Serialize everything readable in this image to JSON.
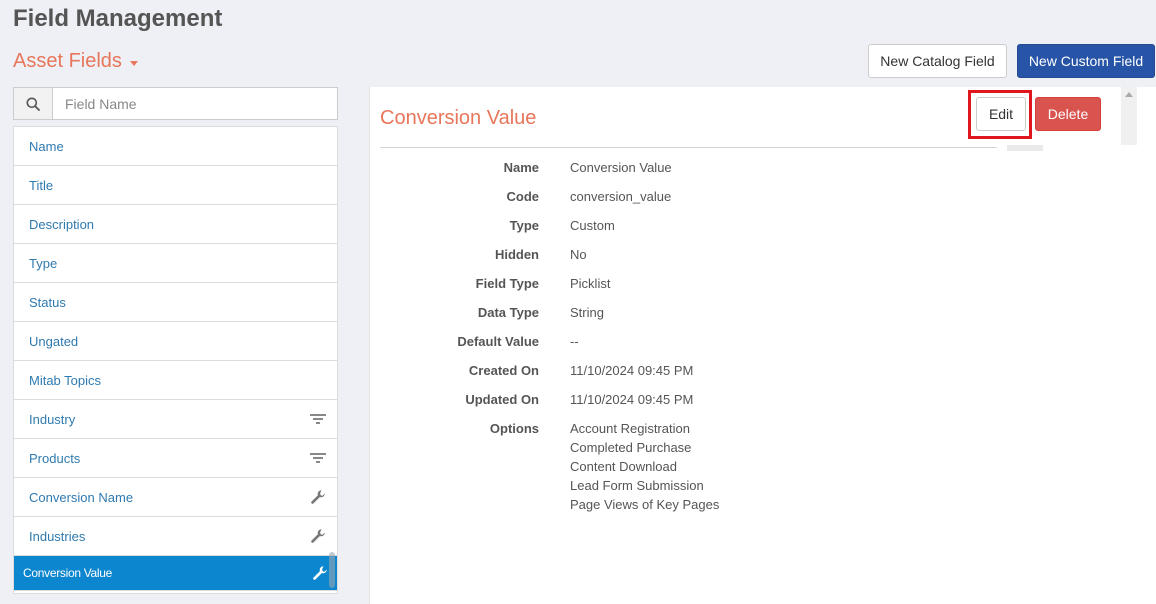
{
  "page": {
    "title": "Field Management"
  },
  "section": {
    "title": "Asset Fields"
  },
  "toolbar": {
    "new_catalog_label": "New Catalog Field",
    "new_custom_label": "New Custom Field"
  },
  "search": {
    "placeholder": "Field Name",
    "value": ""
  },
  "fields": [
    {
      "label": "Name",
      "icon": ""
    },
    {
      "label": "Title",
      "icon": ""
    },
    {
      "label": "Description",
      "icon": ""
    },
    {
      "label": "Type",
      "icon": ""
    },
    {
      "label": "Status",
      "icon": ""
    },
    {
      "label": "Ungated",
      "icon": ""
    },
    {
      "label": "Mitab Topics",
      "icon": ""
    },
    {
      "label": "Industry",
      "icon": "filter-icon"
    },
    {
      "label": "Products",
      "icon": "filter-icon"
    },
    {
      "label": "Conversion Name",
      "icon": "wrench-icon"
    },
    {
      "label": "Industries",
      "icon": "wrench-icon"
    },
    {
      "label": "Conversion Value",
      "icon": "wrench-icon",
      "selected": true
    }
  ],
  "detail": {
    "title": "Conversion Value",
    "edit_label": "Edit",
    "delete_label": "Delete",
    "properties": [
      {
        "label": "Name",
        "value": "Conversion Value"
      },
      {
        "label": "Code",
        "value": "conversion_value"
      },
      {
        "label": "Type",
        "value": "Custom"
      },
      {
        "label": "Hidden",
        "value": "No"
      },
      {
        "label": "Field Type",
        "value": "Picklist"
      },
      {
        "label": "Data Type",
        "value": "String"
      },
      {
        "label": "Default Value",
        "value": "--"
      },
      {
        "label": "Created On",
        "value": "11/10/2024 09:45 PM"
      },
      {
        "label": "Updated On",
        "value": "11/10/2024 09:45 PM"
      }
    ],
    "options_label": "Options",
    "options": [
      "Account Registration",
      "Completed Purchase",
      "Content Download",
      "Lead Form Submission",
      "Page Views of Key Pages"
    ]
  },
  "colors": {
    "accent_orange": "#e8765a",
    "primary_blue": "#2754a6",
    "link_blue": "#2f7ab0",
    "selected_blue": "#0c86cf",
    "danger_red": "#d9534f",
    "highlight_red": "#e0161e"
  }
}
